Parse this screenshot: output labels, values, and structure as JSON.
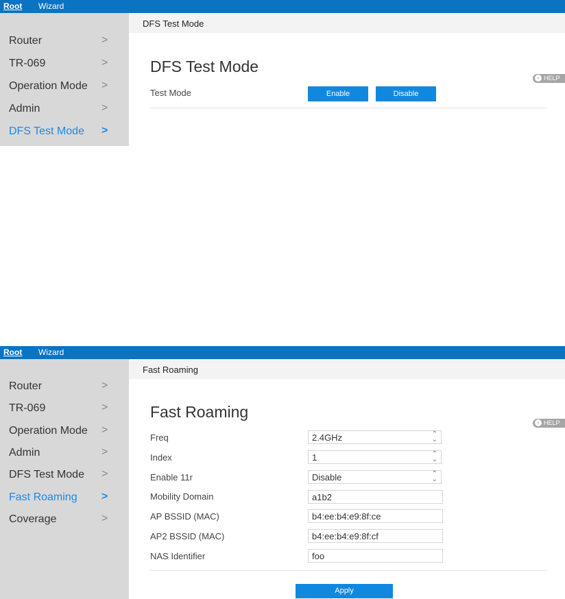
{
  "panel1": {
    "topbar": {
      "root": "Root",
      "wizard": "Wizard"
    },
    "sidebar": {
      "items": [
        {
          "label": "Router"
        },
        {
          "label": "TR-069"
        },
        {
          "label": "Operation Mode"
        },
        {
          "label": "Admin"
        },
        {
          "label": "DFS Test Mode",
          "active": true
        }
      ],
      "chevron": ">"
    },
    "breadcrumb": "DFS Test Mode",
    "title": "DFS Test Mode",
    "help": "HELP",
    "test_mode_label": "Test Mode",
    "enable_button": "Enable",
    "disable_button": "Disable"
  },
  "panel2": {
    "topbar": {
      "root": "Root",
      "wizard": "Wizard"
    },
    "sidebar": {
      "items": [
        {
          "label": "Router"
        },
        {
          "label": "TR-069"
        },
        {
          "label": "Operation Mode"
        },
        {
          "label": "Admin"
        },
        {
          "label": "DFS Test Mode"
        },
        {
          "label": "Fast Roaming",
          "active": true
        },
        {
          "label": "Coverage"
        }
      ],
      "chevron": ">"
    },
    "breadcrumb": "Fast Roaming",
    "title": "Fast Roaming",
    "help": "HELP",
    "fields": [
      {
        "label": "Freq",
        "value": "2.4GHz",
        "type": "select"
      },
      {
        "label": "Index",
        "value": "1",
        "type": "select"
      },
      {
        "label": "Enable 11r",
        "value": "Disable",
        "type": "select"
      },
      {
        "label": "Mobility Domain",
        "value": "a1b2",
        "type": "text"
      },
      {
        "label": "AP BSSID (MAC)",
        "value": "b4:ee:b4:e9:8f:ce",
        "type": "text"
      },
      {
        "label": "AP2 BSSID (MAC)",
        "value": "b4:ee:b4:e9:8f:cf",
        "type": "text"
      },
      {
        "label": "NAS Identifier",
        "value": "foo",
        "type": "text"
      }
    ],
    "apply_button": "Apply"
  },
  "colors": {
    "topbar": "#0a73c2",
    "accent": "#1e88e5",
    "button": "#1188e0",
    "sidebar": "#d8d8d8"
  }
}
